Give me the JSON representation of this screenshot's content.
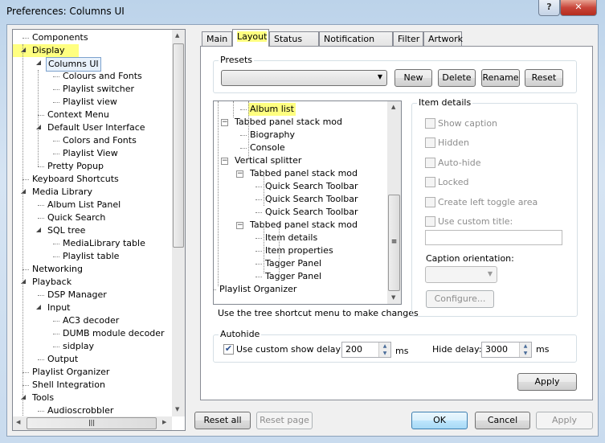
{
  "window": {
    "title": "Preferences: Columns UI",
    "help_icon": "question-icon",
    "close_icon": "close-x-icon"
  },
  "colors": {
    "highlight": "#ffff80",
    "close": "#c8453a"
  },
  "left_tree": [
    {
      "label": "Components",
      "level": 0
    },
    {
      "label": "Display",
      "level": 0,
      "expanded": true,
      "highlight": true
    },
    {
      "label": "Columns UI",
      "level": 1,
      "expanded": true,
      "selected": true,
      "highlight": true
    },
    {
      "label": "Colours and Fonts",
      "level": 2
    },
    {
      "label": "Playlist switcher",
      "level": 2
    },
    {
      "label": "Playlist view",
      "level": 2
    },
    {
      "label": "Context Menu",
      "level": 1
    },
    {
      "label": "Default User Interface",
      "level": 1,
      "expanded": true
    },
    {
      "label": "Colors and Fonts",
      "level": 2
    },
    {
      "label": "Playlist View",
      "level": 2
    },
    {
      "label": "Pretty Popup",
      "level": 1
    },
    {
      "label": "Keyboard Shortcuts",
      "level": 0
    },
    {
      "label": "Media Library",
      "level": 0,
      "expanded": true
    },
    {
      "label": "Album List Panel",
      "level": 1
    },
    {
      "label": "Quick Search",
      "level": 1
    },
    {
      "label": "SQL tree",
      "level": 1,
      "expanded": true
    },
    {
      "label": "MediaLibrary table",
      "level": 2
    },
    {
      "label": "Playlist table",
      "level": 2
    },
    {
      "label": "Networking",
      "level": 0
    },
    {
      "label": "Playback",
      "level": 0,
      "expanded": true
    },
    {
      "label": "DSP Manager",
      "level": 1
    },
    {
      "label": "Input",
      "level": 1,
      "expanded": true
    },
    {
      "label": "AC3 decoder",
      "level": 2
    },
    {
      "label": "DUMB module decoder",
      "level": 2
    },
    {
      "label": "sidplay",
      "level": 2
    },
    {
      "label": "Output",
      "level": 1
    },
    {
      "label": "Playlist Organizer",
      "level": 0
    },
    {
      "label": "Shell Integration",
      "level": 0
    },
    {
      "label": "Tools",
      "level": 0,
      "expanded": true
    },
    {
      "label": "Audioscrobbler",
      "level": 1
    }
  ],
  "tabs": [
    {
      "label": "Main"
    },
    {
      "label": "Layout",
      "active": true,
      "highlight": true
    },
    {
      "label": "Status bar"
    },
    {
      "label": "Notification area"
    },
    {
      "label": "Filter"
    },
    {
      "label": "Artwork"
    }
  ],
  "presets": {
    "label": "Presets",
    "value": "",
    "buttons": {
      "new": "New",
      "delete": "Delete",
      "rename": "Rename",
      "reset": "Reset"
    }
  },
  "layout_tree": [
    {
      "label": "Album list",
      "level": 3,
      "highlight": true
    },
    {
      "label": "Tabbed panel stack mod",
      "level": 2,
      "expanded": true
    },
    {
      "label": "Biography",
      "level": 3
    },
    {
      "label": "Console",
      "level": 3
    },
    {
      "label": "Vertical splitter",
      "level": 2,
      "expanded": true
    },
    {
      "label": "Tabbed panel stack mod",
      "level": 3,
      "expanded": true
    },
    {
      "label": "Quick Search Toolbar",
      "level": 4
    },
    {
      "label": "Quick Search Toolbar",
      "level": 4
    },
    {
      "label": "Quick Search Toolbar",
      "level": 4
    },
    {
      "label": "Tabbed panel stack mod",
      "level": 3,
      "expanded": true
    },
    {
      "label": "Item details",
      "level": 4
    },
    {
      "label": "Item properties",
      "level": 4
    },
    {
      "label": "Tagger Panel",
      "level": 4
    },
    {
      "label": "Tagger Panel",
      "level": 4
    },
    {
      "label": "Playlist Organizer",
      "level": 1
    }
  ],
  "hint": "Use the tree shortcut menu to make changes",
  "item_details": {
    "label": "Item details",
    "checkboxes": [
      {
        "label": "Show caption",
        "checked": false
      },
      {
        "label": "Hidden",
        "checked": false
      },
      {
        "label": "Auto-hide",
        "checked": false
      },
      {
        "label": "Locked",
        "checked": false
      },
      {
        "label": "Create left toggle area",
        "checked": false
      },
      {
        "label": "Use custom title:",
        "checked": false
      }
    ],
    "custom_title_value": "",
    "caption_orientation_label": "Caption orientation:",
    "caption_orientation_value": "",
    "configure": "Configure..."
  },
  "autohide": {
    "label": "Autohide",
    "use_custom": "Use custom show delay of",
    "use_custom_checked": true,
    "show_delay": "200",
    "ms1": "ms",
    "hide_delay_label": "Hide delay:",
    "hide_delay": "3000",
    "ms2": "ms"
  },
  "panel_apply": "Apply",
  "footer": {
    "reset_all": "Reset all",
    "reset_page": "Reset page",
    "ok": "OK",
    "cancel": "Cancel",
    "apply": "Apply"
  }
}
